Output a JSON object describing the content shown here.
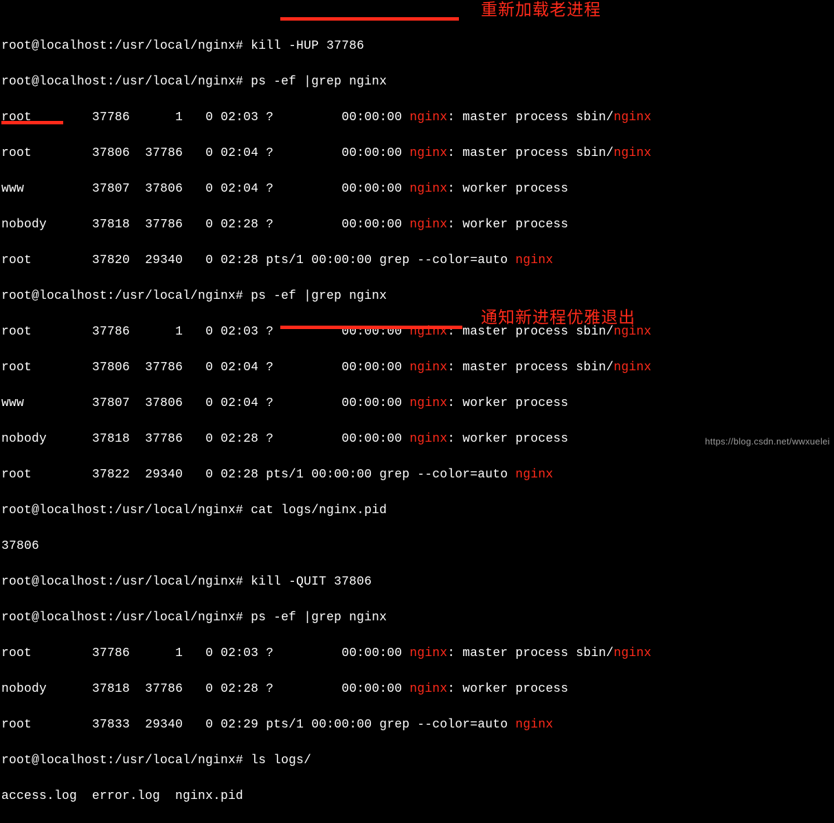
{
  "prompt": "root@localhost:/usr/local/nginx# ",
  "annotations": {
    "a1": "重新加载老进程",
    "a2": "通知新进程优雅退出"
  },
  "cmd": {
    "kill_hup": "kill -HUP 37786",
    "ps1": "ps -ef |grep nginx",
    "ps2": "ps -ef |grep nginx",
    "cat_pid": "cat logs/nginx.pid",
    "kill_quit": "kill -QUIT 37806",
    "ps3": "ps -ef |grep nginx",
    "ls_logs": "ls logs/"
  },
  "pid_file": "37806",
  "logs_listing": "access.log  error.log  nginx.pid",
  "ps_rows_1": {
    "r0": {
      "user": "root      ",
      "pid": "37786",
      "ppid": "     1",
      "c": "0",
      "stime": "02:03",
      "tty": "?    ",
      "time": "00:00:00",
      "cmd_pre": "",
      "cmd_red1": "nginx",
      "cmd_mid": ": master process sbin/",
      "cmd_red2": "nginx",
      "cmd_post": ""
    },
    "r1": {
      "user": "root      ",
      "pid": "37806",
      "ppid": " 37786",
      "c": "0",
      "stime": "02:04",
      "tty": "?    ",
      "time": "00:00:00",
      "cmd_pre": "",
      "cmd_red1": "nginx",
      "cmd_mid": ": master process sbin/",
      "cmd_red2": "nginx",
      "cmd_post": ""
    },
    "r2": {
      "user": "www       ",
      "pid": "37807",
      "ppid": " 37806",
      "c": "0",
      "stime": "02:04",
      "tty": "?    ",
      "time": "00:00:00",
      "cmd_pre": "",
      "cmd_red1": "nginx",
      "cmd_mid": ": worker process",
      "cmd_red2": "",
      "cmd_post": ""
    },
    "r3": {
      "user": "nobody    ",
      "pid": "37818",
      "ppid": " 37786",
      "c": "0",
      "stime": "02:28",
      "tty": "?    ",
      "time": "00:00:00",
      "cmd_pre": "",
      "cmd_red1": "nginx",
      "cmd_mid": ": worker process",
      "cmd_red2": "",
      "cmd_post": ""
    },
    "r4": {
      "user": "root      ",
      "pid": "37820",
      "ppid": " 29340",
      "c": "0",
      "stime": "02:28",
      "tty": "pts/1",
      "time": "00:00:00",
      "cmd_pre": "grep --color=auto ",
      "cmd_red1": "nginx",
      "cmd_mid": "",
      "cmd_red2": "",
      "cmd_post": ""
    }
  },
  "ps_rows_2": {
    "r0": {
      "user": "root      ",
      "pid": "37786",
      "ppid": "     1",
      "c": "0",
      "stime": "02:03",
      "tty": "?    ",
      "time": "00:00:00",
      "cmd_pre": "",
      "cmd_red1": "nginx",
      "cmd_mid": ": master process sbin/",
      "cmd_red2": "nginx",
      "cmd_post": ""
    },
    "r1": {
      "user": "root      ",
      "pid": "37806",
      "ppid": " 37786",
      "c": "0",
      "stime": "02:04",
      "tty": "?    ",
      "time": "00:00:00",
      "cmd_pre": "",
      "cmd_red1": "nginx",
      "cmd_mid": ": master process sbin/",
      "cmd_red2": "nginx",
      "cmd_post": ""
    },
    "r2": {
      "user": "www       ",
      "pid": "37807",
      "ppid": " 37806",
      "c": "0",
      "stime": "02:04",
      "tty": "?    ",
      "time": "00:00:00",
      "cmd_pre": "",
      "cmd_red1": "nginx",
      "cmd_mid": ": worker process",
      "cmd_red2": "",
      "cmd_post": ""
    },
    "r3": {
      "user": "nobody    ",
      "pid": "37818",
      "ppid": " 37786",
      "c": "0",
      "stime": "02:28",
      "tty": "?    ",
      "time": "00:00:00",
      "cmd_pre": "",
      "cmd_red1": "nginx",
      "cmd_mid": ": worker process",
      "cmd_red2": "",
      "cmd_post": ""
    },
    "r4": {
      "user": "root      ",
      "pid": "37822",
      "ppid": " 29340",
      "c": "0",
      "stime": "02:28",
      "tty": "pts/1",
      "time": "00:00:00",
      "cmd_pre": "grep --color=auto ",
      "cmd_red1": "nginx",
      "cmd_mid": "",
      "cmd_red2": "",
      "cmd_post": ""
    }
  },
  "ps_rows_3": {
    "r0": {
      "user": "root      ",
      "pid": "37786",
      "ppid": "     1",
      "c": "0",
      "stime": "02:03",
      "tty": "?    ",
      "time": "00:00:00",
      "cmd_pre": "",
      "cmd_red1": "nginx",
      "cmd_mid": ": master process sbin/",
      "cmd_red2": "nginx",
      "cmd_post": ""
    },
    "r1": {
      "user": "nobody    ",
      "pid": "37818",
      "ppid": " 37786",
      "c": "0",
      "stime": "02:28",
      "tty": "?    ",
      "time": "00:00:00",
      "cmd_pre": "",
      "cmd_red1": "nginx",
      "cmd_mid": ": worker process",
      "cmd_red2": "",
      "cmd_post": ""
    },
    "r2": {
      "user": "root      ",
      "pid": "37833",
      "ppid": " 29340",
      "c": "0",
      "stime": "02:29",
      "tty": "pts/1",
      "time": "00:00:00",
      "cmd_pre": "grep --color=auto ",
      "cmd_red1": "nginx",
      "cmd_mid": "",
      "cmd_red2": "",
      "cmd_post": ""
    }
  },
  "watermark": "https://blog.csdn.net/wwxuelei"
}
